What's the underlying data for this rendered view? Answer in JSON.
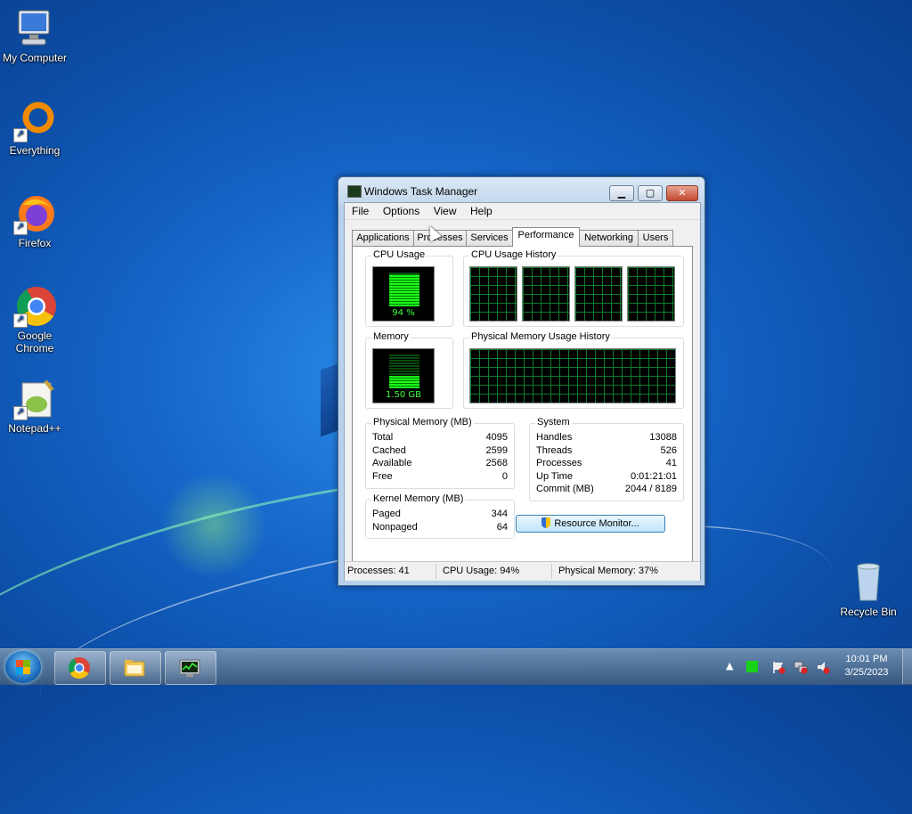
{
  "desktop": {
    "icons": [
      {
        "label": "My Computer",
        "icon": "computer-icon"
      },
      {
        "label": "Everything",
        "icon": "everything-icon"
      },
      {
        "label": "Firefox",
        "icon": "firefox-icon"
      },
      {
        "label": "Google Chrome",
        "icon": "chrome-icon"
      },
      {
        "label": "Notepad++",
        "icon": "notepadpp-icon"
      },
      {
        "label": "Recycle Bin",
        "icon": "recycle-bin-icon"
      }
    ]
  },
  "window": {
    "title": "Windows Task Manager",
    "controls": {
      "minimize": "▁",
      "maximize": "▢",
      "close": "✕"
    },
    "menu": [
      "File",
      "Options",
      "View",
      "Help"
    ],
    "tabs": [
      "Applications",
      "Processes",
      "Services",
      "Performance",
      "Networking",
      "Users"
    ],
    "active_tab": "Performance",
    "cpu_usage": {
      "label": "CPU Usage",
      "value": "94 %",
      "percent": 94
    },
    "cpu_history": {
      "label": "CPU Usage History"
    },
    "memory": {
      "label": "Memory",
      "value": "1.50 GB",
      "percent": 37
    },
    "memory_history": {
      "label": "Physical Memory Usage History"
    },
    "physical_memory": {
      "label": "Physical Memory (MB)",
      "rows": [
        {
          "key": "Total",
          "value": "4095"
        },
        {
          "key": "Cached",
          "value": "2599"
        },
        {
          "key": "Available",
          "value": "2568"
        },
        {
          "key": "Free",
          "value": "0"
        }
      ]
    },
    "kernel_memory": {
      "label": "Kernel Memory (MB)",
      "rows": [
        {
          "key": "Paged",
          "value": "344"
        },
        {
          "key": "Nonpaged",
          "value": "64"
        }
      ]
    },
    "system": {
      "label": "System",
      "rows": [
        {
          "key": "Handles",
          "value": "13088"
        },
        {
          "key": "Threads",
          "value": "526"
        },
        {
          "key": "Processes",
          "value": "41"
        },
        {
          "key": "Up Time",
          "value": "0:01:21:01"
        },
        {
          "key": "Commit (MB)",
          "value": "2044 / 8189"
        }
      ]
    },
    "resource_monitor_button": "Resource Monitor...",
    "status": {
      "processes": "Processes: 41",
      "cpu": "CPU Usage: 94%",
      "memory": "Physical Memory: 37%"
    }
  },
  "taskbar": {
    "pinned": [
      "chrome-icon",
      "explorer-icon",
      "task-manager-icon"
    ],
    "clock": {
      "time": "10:01 PM",
      "date": "3/25/2023"
    },
    "tray_arrow": "▲"
  },
  "colors": {
    "graph_green": "#1aff1a",
    "grid_green": "#0b7d2b"
  }
}
